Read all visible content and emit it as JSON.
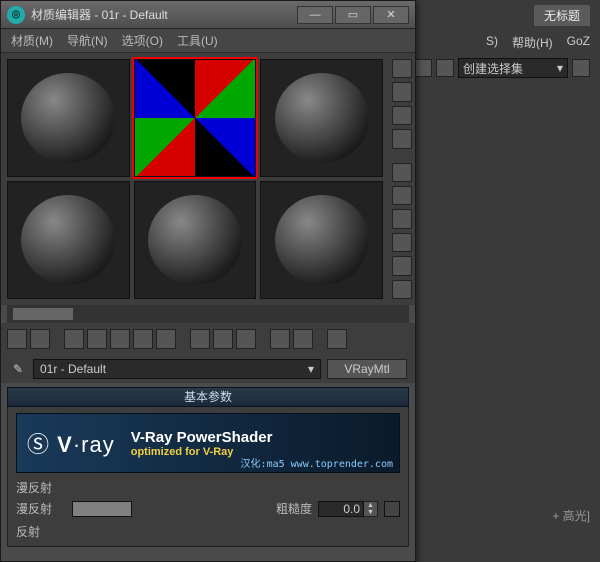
{
  "bg": {
    "untitled_tab": "无标题",
    "menu_s": "S)",
    "menu_help": "帮助(H)",
    "menu_goz": "GoZ",
    "select_set": "创建选择集",
    "highlight_label": "+ 高光]"
  },
  "win": {
    "title": "材质编辑器 - 01r - Default",
    "menu": {
      "material": "材质(M)",
      "navigate": "导航(N)",
      "options": "选项(O)",
      "tools": "工具(U)"
    },
    "name_field": "01r - Default",
    "type_button": "VRayMtl",
    "rollup_basic": "基本参数",
    "vray": {
      "logo_pre": "V",
      "logo_dot": "·",
      "logo_post": "ray",
      "line1": "V-Ray PowerShader",
      "line2": "optimized for V-Ray",
      "credit": "汉化:ma5 www.toprender.com"
    },
    "diffuse_section": "漫反射",
    "diffuse_label": "漫反射",
    "roughness_label": "粗糙度",
    "roughness_value": "0.0",
    "reflect_section": "反射"
  },
  "sideIcons": [
    "sample-type",
    "backlight",
    "background",
    "uv-tile",
    "color-check",
    "make-preview",
    "options",
    "select-by",
    "material-id",
    "pick-from"
  ]
}
